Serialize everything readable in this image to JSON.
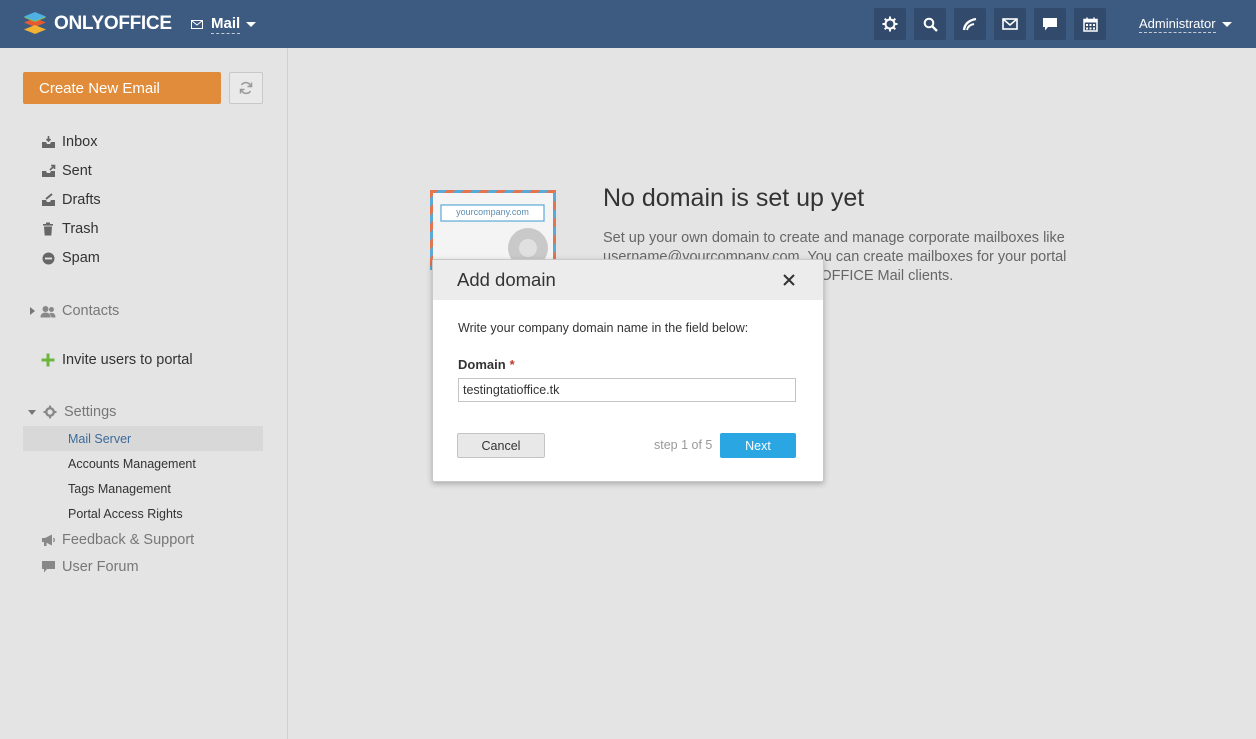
{
  "header": {
    "logo_text": "ONLYOFFICE",
    "module_label": "Mail",
    "user_label": "Administrator",
    "toolbar_icons": [
      "settings-icon",
      "search-icon",
      "feed-icon",
      "mail-icon",
      "chat-icon",
      "calendar-icon"
    ]
  },
  "sidebar": {
    "create_label": "Create New Email",
    "folders": [
      {
        "label": "Inbox",
        "icon": "inbox-icon"
      },
      {
        "label": "Sent",
        "icon": "sent-icon"
      },
      {
        "label": "Drafts",
        "icon": "drafts-icon"
      },
      {
        "label": "Trash",
        "icon": "trash-icon"
      },
      {
        "label": "Spam",
        "icon": "spam-icon"
      }
    ],
    "contacts_label": "Contacts",
    "invite_label": "Invite users to portal",
    "settings_label": "Settings",
    "settings_items": [
      "Mail Server",
      "Accounts Management",
      "Tags Management",
      "Portal Access Rights"
    ],
    "feedback_label": "Feedback & Support",
    "forum_label": "User Forum"
  },
  "empty_state": {
    "title": "No domain is set up yet",
    "description": "Set up your own domain to create and manage corporate mailboxes like username@yourcompany.com. You can create mailboxes for your portal users and use them in their ONLYOFFICE Mail clients.",
    "envelope_text": "yourcompany.com"
  },
  "dialog": {
    "title": "Add domain",
    "instruction": "Write your company domain name in the field below:",
    "domain_label": "Domain",
    "required_mark": "*",
    "domain_value": "testingtatioffice.tk",
    "cancel_label": "Cancel",
    "step_text": "step 1 of 5",
    "next_label": "Next"
  },
  "colors": {
    "topbar": "#3d5a80",
    "create_button": "#e08c3a",
    "next_button": "#2aa7e3"
  }
}
